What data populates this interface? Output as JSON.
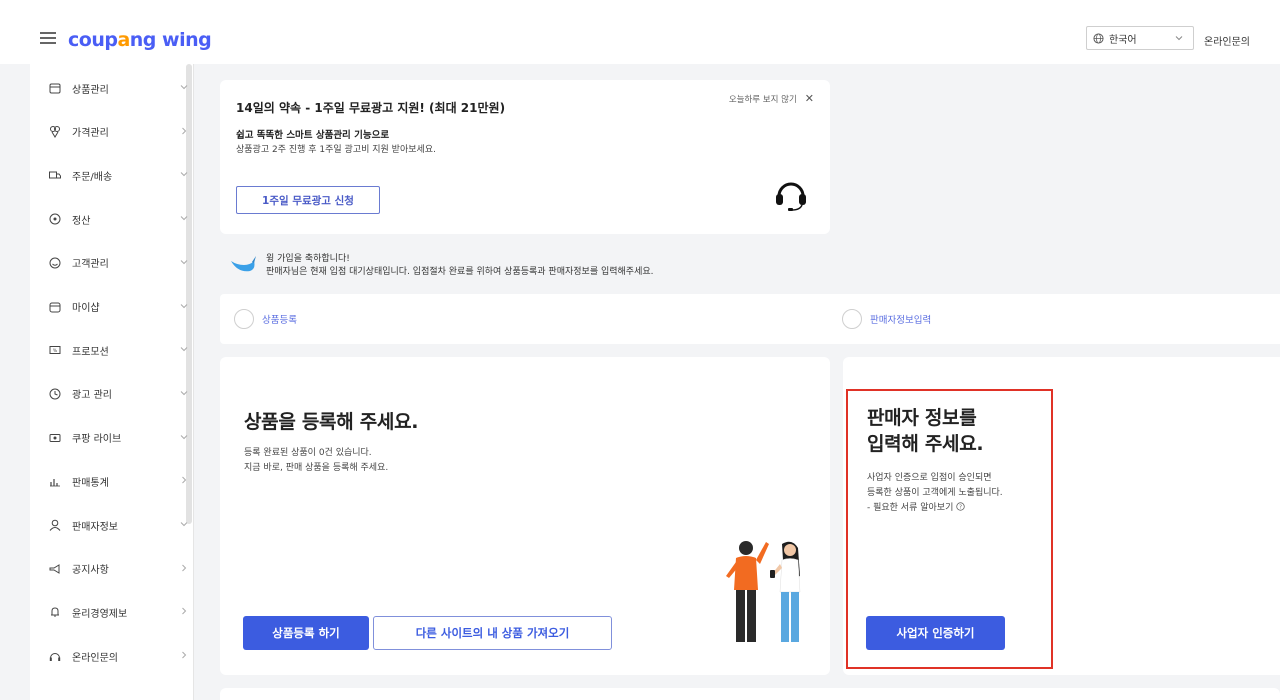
{
  "header": {
    "logo": {
      "part1": "coup",
      "part2": "a",
      "part3": "ng",
      "part4": " wing"
    },
    "language": "한국어",
    "online_inquiry": "온라인문의"
  },
  "sidebar": {
    "items": [
      {
        "label": "상품관리",
        "icon": "box-icon"
      },
      {
        "label": "가격관리",
        "icon": "price-tag-icon"
      },
      {
        "label": "주문/배송",
        "icon": "truck-icon"
      },
      {
        "label": "정산",
        "icon": "coin-icon"
      },
      {
        "label": "고객관리",
        "icon": "smile-icon"
      },
      {
        "label": "마이샵",
        "icon": "shop-icon"
      },
      {
        "label": "프로모션",
        "icon": "coupon-icon"
      },
      {
        "label": "광고 관리",
        "icon": "ad-icon"
      },
      {
        "label": "쿠팡 라이브",
        "icon": "live-icon"
      },
      {
        "label": "판매통계",
        "icon": "bar-chart-icon"
      },
      {
        "label": "판매자정보",
        "icon": "user-icon"
      },
      {
        "label": "공지사항",
        "icon": "megaphone-icon"
      },
      {
        "label": "윤리경영제보",
        "icon": "bell-icon"
      },
      {
        "label": "온라인문의",
        "icon": "headset-icon"
      }
    ]
  },
  "promo": {
    "title": "14일의 약속 - 1주일 무료광고 지원! (최대 21만원)",
    "close_text": "오늘하루 보지 않기",
    "close_x": "✕",
    "line1": "쉽고 똑똑한 스마트 상품관리 기능으로",
    "line2": "상품광고 2주 진행 후 1주일 광고비 지원 받아보세요.",
    "button": "1주일 무료광고 신청"
  },
  "welcome": {
    "line1": "윙 가입을 축하합니다!",
    "line2": "판매자님은 현재 입점 대기상태입니다. 입점절차 완료를 위하여 상품등록과 판매자정보를 입력해주세요."
  },
  "steps": [
    {
      "label": "상품등록"
    },
    {
      "label": "판매자정보입력"
    }
  ],
  "product_card": {
    "title": "상품을 등록해 주세요.",
    "desc1": "등록 완료된 상품이 0건 있습니다.",
    "desc2": "지금 바로, 판매 상품을 등록해 주세요.",
    "btn_register": "상품등록 하기",
    "btn_import": "다른 사이트의 내 상품 가져오기"
  },
  "seller_card": {
    "title1": "판매자 정보를",
    "title2": "입력해 주세요.",
    "desc1": "사업자 인증으로 입점이 승인되면",
    "desc2": "등록한 상품이 고객에게 노출됩니다.",
    "desc3": "- 필요한 서류 알아보기",
    "btn_verify": "사업자 인증하기"
  },
  "colors": {
    "primary": "#3c5ce0",
    "highlight": "#e03226",
    "logo_orange": "#ff9a00"
  }
}
